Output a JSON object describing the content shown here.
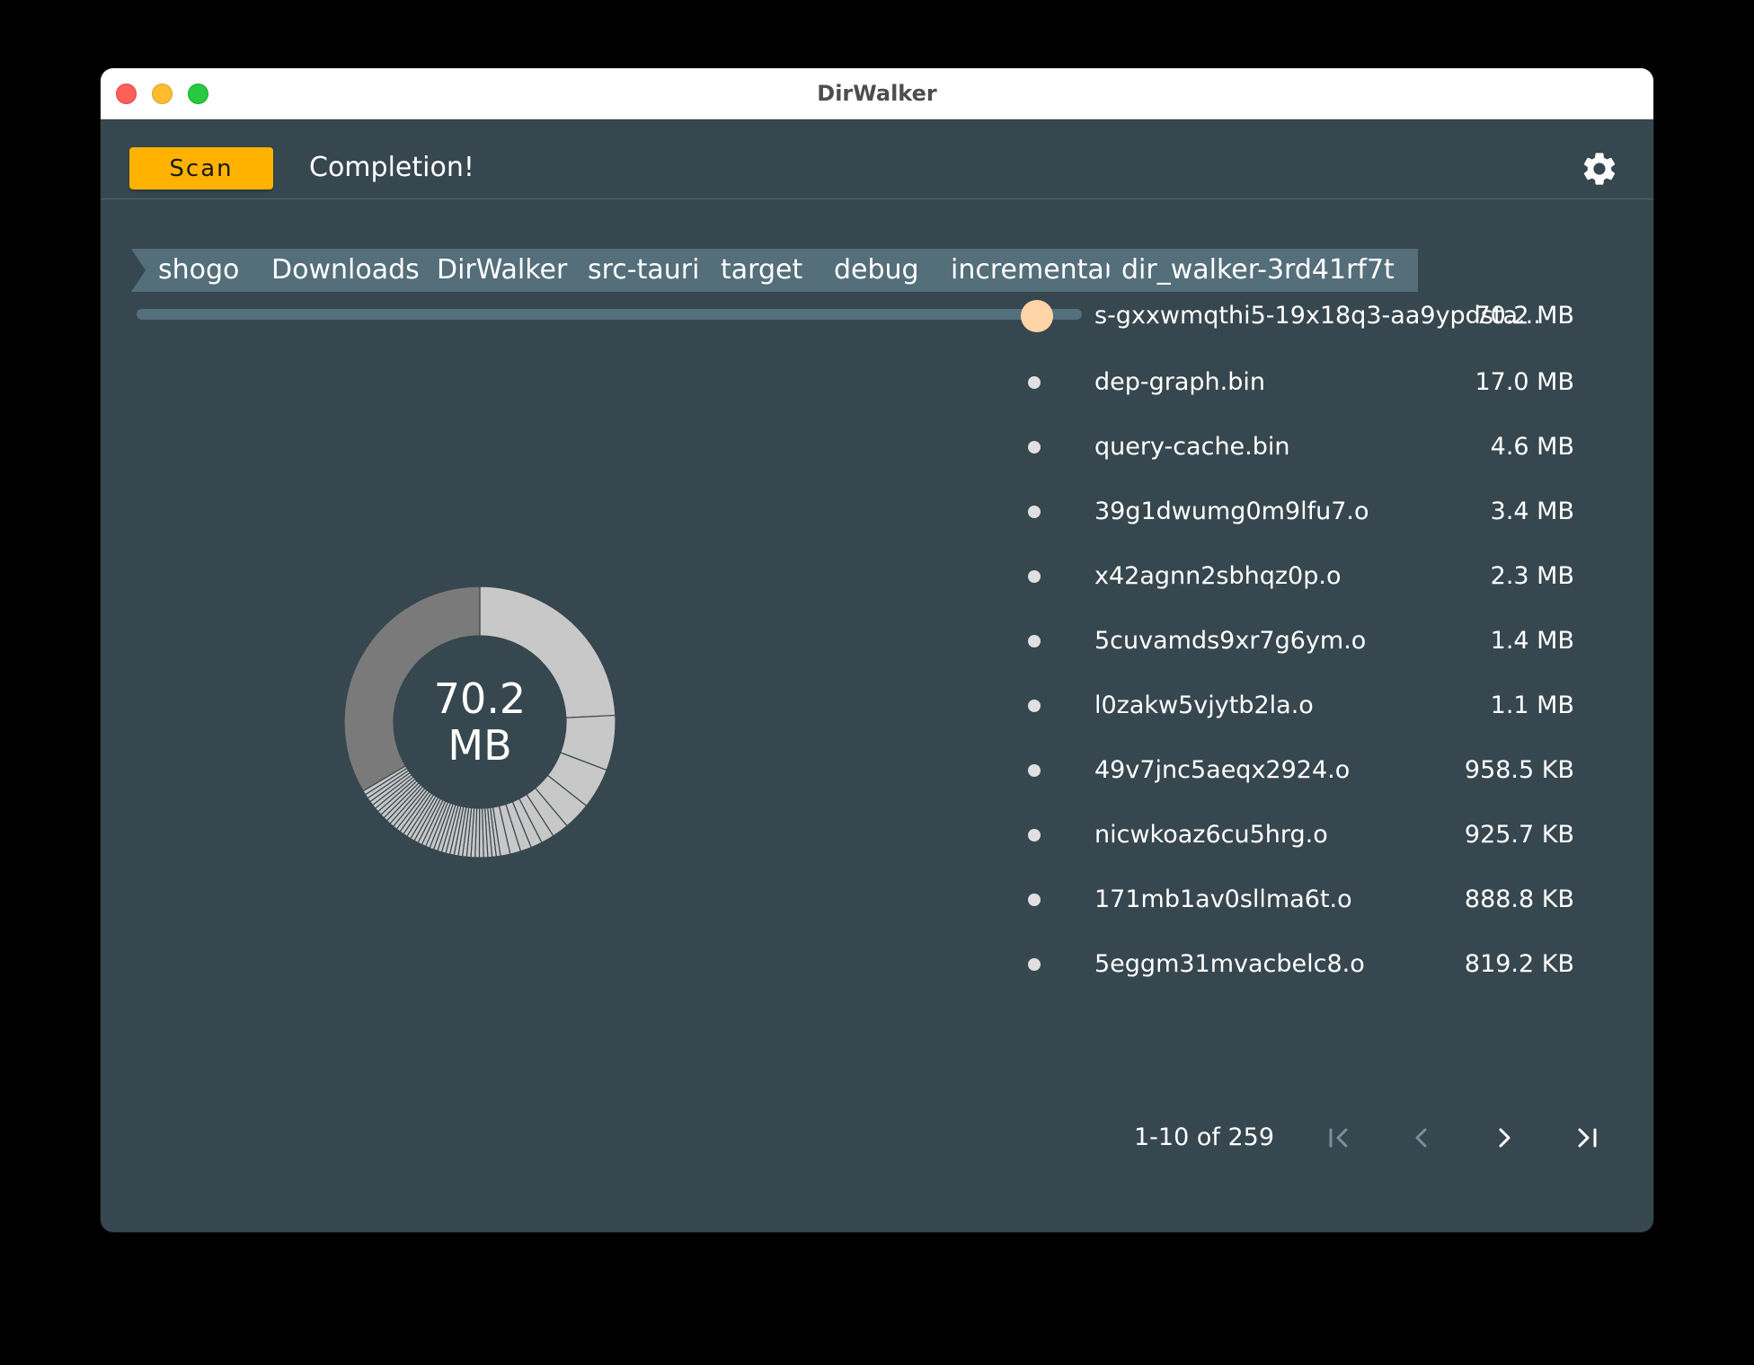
{
  "window": {
    "title": "DirWalker"
  },
  "toolbar": {
    "scan_label": "Scan",
    "status": "Completion!",
    "settings_icon": "gear-icon"
  },
  "breadcrumbs": [
    "shogo",
    "Downloads",
    "DirWalker",
    "src-tauri",
    "target",
    "debug",
    "incremental",
    "dir_walker-3rd41rf7t"
  ],
  "chart": {
    "center_value": "70.2",
    "center_unit": "MB",
    "colors": {
      "light": "#c8c8c8",
      "dark": "#7a7a7a",
      "stroke": "#37474f"
    }
  },
  "chart_data": {
    "type": "pie",
    "categories": [
      "dep-graph.bin",
      "query-cache.bin",
      "39g1dwumg0m9lfu7.o",
      "x42agnn2sbhqz0p.o",
      "5cuvamds9xr7g6ym.o",
      "l0zakw5vjytb2la.o",
      "49v7jnc5aeqx2924.o",
      "nicwkoaz6cu5hrg.o",
      "171mb1av0sllma6t.o",
      "5eggm31mvacbelc8.o"
    ],
    "values": [
      17.0,
      4.6,
      3.4,
      2.3,
      1.4,
      1.1,
      0.9585,
      0.9257,
      0.8888,
      0.8192
    ],
    "total": 70.2,
    "unit": "MB"
  },
  "list": {
    "header": {
      "name": "s-gxxwmqthi5-19x18q3-aa9ypdsta...",
      "size": "70.2 MB",
      "color": "#ffd5a8"
    },
    "items": [
      {
        "name": "dep-graph.bin",
        "size": "17.0 MB"
      },
      {
        "name": "query-cache.bin",
        "size": "4.6 MB"
      },
      {
        "name": "39g1dwumg0m9lfu7.o",
        "size": "3.4 MB"
      },
      {
        "name": "x42agnn2sbhqz0p.o",
        "size": "2.3 MB"
      },
      {
        "name": "5cuvamds9xr7g6ym.o",
        "size": "1.4 MB"
      },
      {
        "name": "l0zakw5vjytb2la.o",
        "size": "1.1 MB"
      },
      {
        "name": "49v7jnc5aeqx2924.o",
        "size": "958.5 KB"
      },
      {
        "name": "nicwkoaz6cu5hrg.o",
        "size": "925.7 KB"
      },
      {
        "name": "171mb1av0sllma6t.o",
        "size": "888.8 KB"
      },
      {
        "name": "5eggm31mvacbelc8.o",
        "size": "819.2 KB"
      }
    ]
  },
  "pagination": {
    "label": "1-10 of 259",
    "first_icon": "first-page-icon",
    "prev_icon": "chevron-left-icon",
    "next_icon": "chevron-right-icon",
    "last_icon": "last-page-icon"
  }
}
